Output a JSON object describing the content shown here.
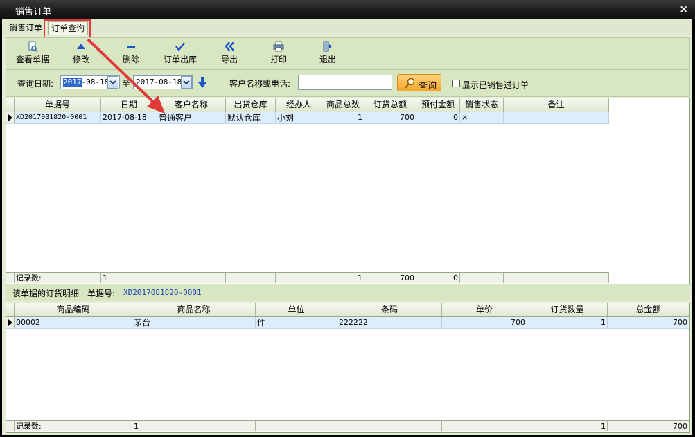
{
  "window": {
    "title": "销售订单",
    "close_glyph": "×"
  },
  "tabs": [
    {
      "label": "销售订单"
    },
    {
      "label": "订单查询"
    }
  ],
  "toolbar": {
    "buttons": [
      {
        "label": "查看单据",
        "icon": "view-doc-icon"
      },
      {
        "label": "修改",
        "icon": "triangle-up-icon"
      },
      {
        "label": "删除",
        "icon": "minus-icon"
      },
      {
        "label": "订单出库",
        "icon": "checkmark-icon"
      },
      {
        "label": "导出",
        "icon": "double-chevron-left-icon"
      },
      {
        "label": "打印",
        "icon": "printer-icon"
      },
      {
        "label": "退出",
        "icon": "exit-door-icon"
      }
    ]
  },
  "filter": {
    "date_label": "查询日期:",
    "date_from_selected": "2017",
    "date_from_rest": "-08-18",
    "to_label": "至",
    "date_to": "2017-08-18",
    "customer_label": "客户名称或电话:",
    "customer_value": "",
    "search_label": "查询",
    "show_sold_label": "显示已销售过订单"
  },
  "orders": {
    "headers": [
      "单据号",
      "日期",
      "客户名称",
      "出货仓库",
      "经办人",
      "商品总数",
      "订货总额",
      "预付金额",
      "销售状态",
      "备注"
    ],
    "rows": [
      [
        "XD2017081820-0001",
        "2017-08-18",
        "普通客户",
        "默认仓库",
        "小刘",
        "1",
        "700",
        "0",
        "×",
        ""
      ]
    ],
    "footer": [
      "记录数:",
      "1",
      "",
      "",
      "",
      "1",
      "700",
      "0",
      "",
      ""
    ]
  },
  "detail": {
    "title": "该单据的订货明细",
    "doc_no_label": "单据号:",
    "doc_no_value": "XD2017081820-0001"
  },
  "items": {
    "headers": [
      "商品编码",
      "商品名称",
      "单位",
      "条码",
      "单价",
      "订货数量",
      "总金额"
    ],
    "rows": [
      [
        "00002",
        "茅台",
        "件",
        "222222",
        "700",
        "1",
        "700"
      ]
    ],
    "footer": [
      "记录数:",
      "1",
      "",
      "",
      "",
      "1",
      "700"
    ]
  },
  "colors": {
    "highlight": "#e03a3a",
    "accent": "#1a56c9",
    "row_selected": "#dceefb"
  }
}
